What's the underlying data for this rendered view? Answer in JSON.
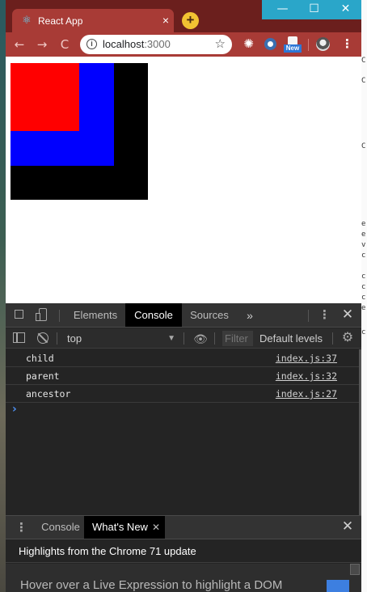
{
  "window": {
    "tab_title": "React App",
    "tab_close": "×",
    "new_tab": "+",
    "caption_minimize": "—",
    "caption_maximize": "☐",
    "caption_close": "✕"
  },
  "toolbar": {
    "back": "←",
    "forward": "→",
    "reload": "C",
    "url_host": "localhost",
    "url_port": ":3000",
    "ext_new_badge": "New"
  },
  "page": {
    "boxes": [
      {
        "name": "ancestor",
        "color": "#000000"
      },
      {
        "name": "parent",
        "color": "#0000ff"
      },
      {
        "name": "child",
        "color": "#ff0000"
      }
    ]
  },
  "devtools": {
    "tabs": [
      "Elements",
      "Console",
      "Sources"
    ],
    "active_tab": "Console",
    "more_tabs": "»",
    "context": "top",
    "filter_placeholder": "Filter",
    "levels": "Default levels",
    "messages": [
      {
        "text": "child",
        "source": "index.js:37"
      },
      {
        "text": "parent",
        "source": "index.js:32"
      },
      {
        "text": "ancestor",
        "source": "index.js:27"
      }
    ],
    "prompt": "›",
    "drawer": {
      "tabs": [
        "Console",
        "What's New"
      ],
      "active_tab": "What's New",
      "headline": "Highlights from the Chrome 71 update",
      "card_text": "Hover over a Live Expression to highlight a DOM"
    }
  },
  "desktop": {
    "right_fragments": [
      "C",
      "C",
      "C",
      "e",
      "e",
      "v",
      "c",
      "c",
      "c",
      "c",
      "e",
      "c"
    ]
  }
}
